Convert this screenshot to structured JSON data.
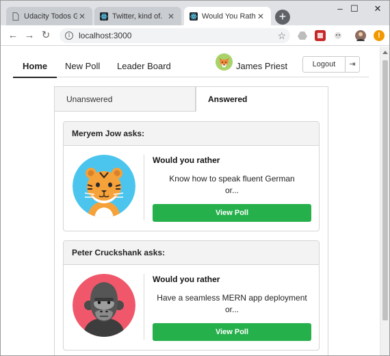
{
  "browser": {
    "tabs": [
      {
        "title": "Udacity Todos Goa",
        "favicon": "document-icon",
        "active": false
      },
      {
        "title": "Twitter, kind of.",
        "favicon": "react-icon",
        "active": false
      },
      {
        "title": "Would You Rather (",
        "favicon": "react-icon",
        "active": true
      }
    ],
    "new_tab": "+",
    "window_controls": {
      "minimize": "–",
      "maximize": "☐",
      "close": "✕"
    },
    "url": "localhost:3000",
    "nav": {
      "back": "←",
      "forward": "→",
      "reload": "↻"
    },
    "star": "☆",
    "info": "i"
  },
  "app_nav": {
    "links": [
      "Home",
      "New Poll",
      "Leader Board"
    ],
    "active": "Home",
    "user_name": "James Priest",
    "logout_label": "Logout",
    "logout_icon": "⇥"
  },
  "poll_tabs": {
    "unanswered": "Unanswered",
    "answered": "Answered",
    "active": "Answered"
  },
  "polls": [
    {
      "author_header": "Meryem Jow asks:",
      "avatar": "tiger-avatar",
      "question_header": "Would you rather",
      "option_preview": "Know how to speak fluent German",
      "or_text": "or...",
      "button_label": "View Poll"
    },
    {
      "author_header": "Peter Cruckshank asks:",
      "avatar": "gorilla-avatar",
      "question_header": "Would you rather",
      "option_preview": "Have a seamless MERN app deployment",
      "or_text": "or...",
      "button_label": "View Poll"
    }
  ],
  "colors": {
    "view_button": "#26b04b",
    "tiger_bg": "#4cc5ee",
    "gorilla_bg": "#f0576b"
  }
}
